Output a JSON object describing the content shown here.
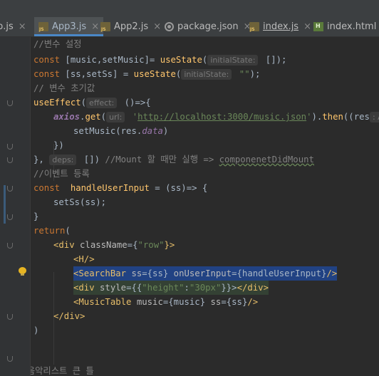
{
  "tabs": [
    {
      "label": "p.js",
      "icon": "javascript-file-icon",
      "active": false
    },
    {
      "label": "App3.js",
      "icon": "javascript-file-icon",
      "active": true
    },
    {
      "label": "App2.js",
      "icon": "javascript-file-icon",
      "active": false
    },
    {
      "label": "package.json",
      "icon": "json-settings-file-icon",
      "active": false
    },
    {
      "label": "index.js",
      "icon": "javascript-file-icon",
      "active": false
    },
    {
      "label": "index.html",
      "icon": "html-file-icon",
      "active": false
    }
  ],
  "close_glyph": "×",
  "code": {
    "l1": "//변수 설정",
    "l2_a": "const ",
    "l2_b": "[music,setMusic]= ",
    "l2_c": "useState",
    "l2_d": "(",
    "l2_hint": "initialState:",
    "l2_e": " []);",
    "l3_a": "const ",
    "l3_b": "[ss,setSs] = ",
    "l3_c": "useState",
    "l3_d": "(",
    "l3_hint": "initialState:",
    "l3_e": " \"\"",
    "l3_f": ");",
    "l4": "// 변수 초기값",
    "l5_a": "useEffect",
    "l5_b": "(",
    "l5_hint": "effect:",
    "l5_c": " ()=>{",
    "l6_a": "axios",
    "l6_b": ".",
    "l6_c": "get",
    "l6_d": "(",
    "l6_hint": "url:",
    "l6_e": " '",
    "l6_url": "http://localhost:3000/music.json",
    "l6_f": "'",
    "l6_g": ").",
    "l6_h": "then",
    "l6_i": "((res",
    "l6_hint2": ": Axios",
    "l7_a": "setMusic",
    "l7_b": "(res.",
    "l7_c": "data",
    "l7_d": ")",
    "l8": "})",
    "l9_a": "}, ",
    "l9_hint": "deps:",
    "l9_b": " []) ",
    "l9_c": "//Mount 할 때만 실행 => ",
    "l9_d": "componenetDidMount",
    "l10": "//이벤트 등록",
    "l11_a": "const ",
    "l11_b": " handleUserInput",
    "l11_c": " = (ss)=> {",
    "l12_a": "setSs",
    "l12_b": "(ss);",
    "l13": "}",
    "l14_a": "return",
    "l14_b": "(",
    "l15_a": "<div ",
    "l15_b": "className",
    "l15_c": "={",
    "l15_d": "\"row\"",
    "l15_e": "}>",
    "l16": "<H/>",
    "l17_a": "<SearchBar ",
    "l17_b": "ss",
    "l17_c": "={ss} ",
    "l17_d": "onUserInput",
    "l17_e": "={handleUserInput}",
    "l17_f": "/>",
    "l18_a": "<div ",
    "l18_b": "style",
    "l18_c": "={{",
    "l18_d": "\"height\"",
    "l18_e": ":",
    "l18_f": "\"30px\"",
    "l18_g": "}}>",
    "l18_h": "</div>",
    "l19_a": "<MusicTable ",
    "l19_b": "music",
    "l19_c": "={music} ",
    "l19_d": "ss",
    "l19_e": "={ss}",
    "l19_f": "/>",
    "l20": "</div>",
    "l21": ")",
    "l22": "}",
    "l23": "//음악리스트 큰 틀"
  }
}
